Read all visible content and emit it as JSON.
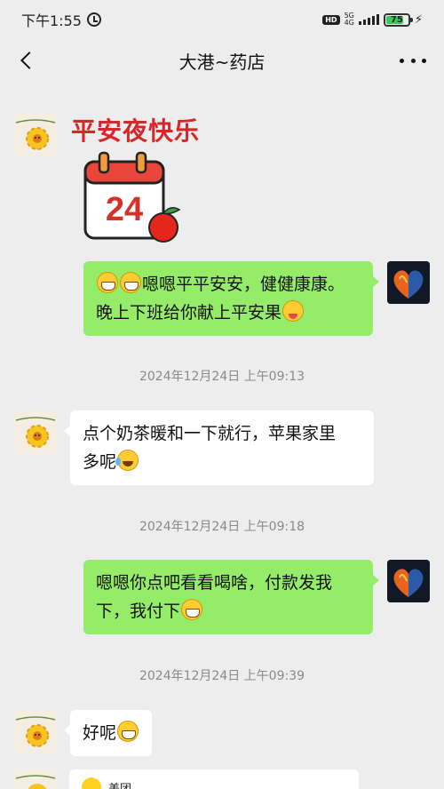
{
  "status_bar": {
    "time": "下午1:55",
    "hd": "HD",
    "network_top": "5G",
    "network_bottom": "4G",
    "battery": "75"
  },
  "nav": {
    "title": "大港~药店"
  },
  "messages": [
    {
      "side": "left",
      "type": "sticker",
      "text": "平安夜快乐",
      "sticker_number": "24"
    },
    {
      "side": "right",
      "type": "text",
      "lines": [
        "嗯嗯平平安安，健健康康。",
        "晚上下班给你献上平安果"
      ]
    },
    {
      "type": "time",
      "text": "2024年12月24日 上午09:13"
    },
    {
      "side": "left",
      "type": "text",
      "lines": [
        "点个奶茶暖和一下就行，苹果家里",
        "多呢"
      ]
    },
    {
      "type": "time",
      "text": "2024年12月24日 上午09:18"
    },
    {
      "side": "right",
      "type": "text",
      "lines": [
        "嗯嗯你点吧看看喝啥，付款发我",
        "下，我付下"
      ]
    },
    {
      "type": "time",
      "text": "2024年12月24日 上午09:39"
    },
    {
      "side": "left",
      "type": "text",
      "lines": [
        "好呢"
      ]
    },
    {
      "side": "left",
      "type": "card",
      "title": "美团"
    }
  ],
  "colors": {
    "background": "#ededed",
    "green_bubble": "#95ec69",
    "white_bubble": "#ffffff",
    "sticker_red": "#d62828"
  }
}
